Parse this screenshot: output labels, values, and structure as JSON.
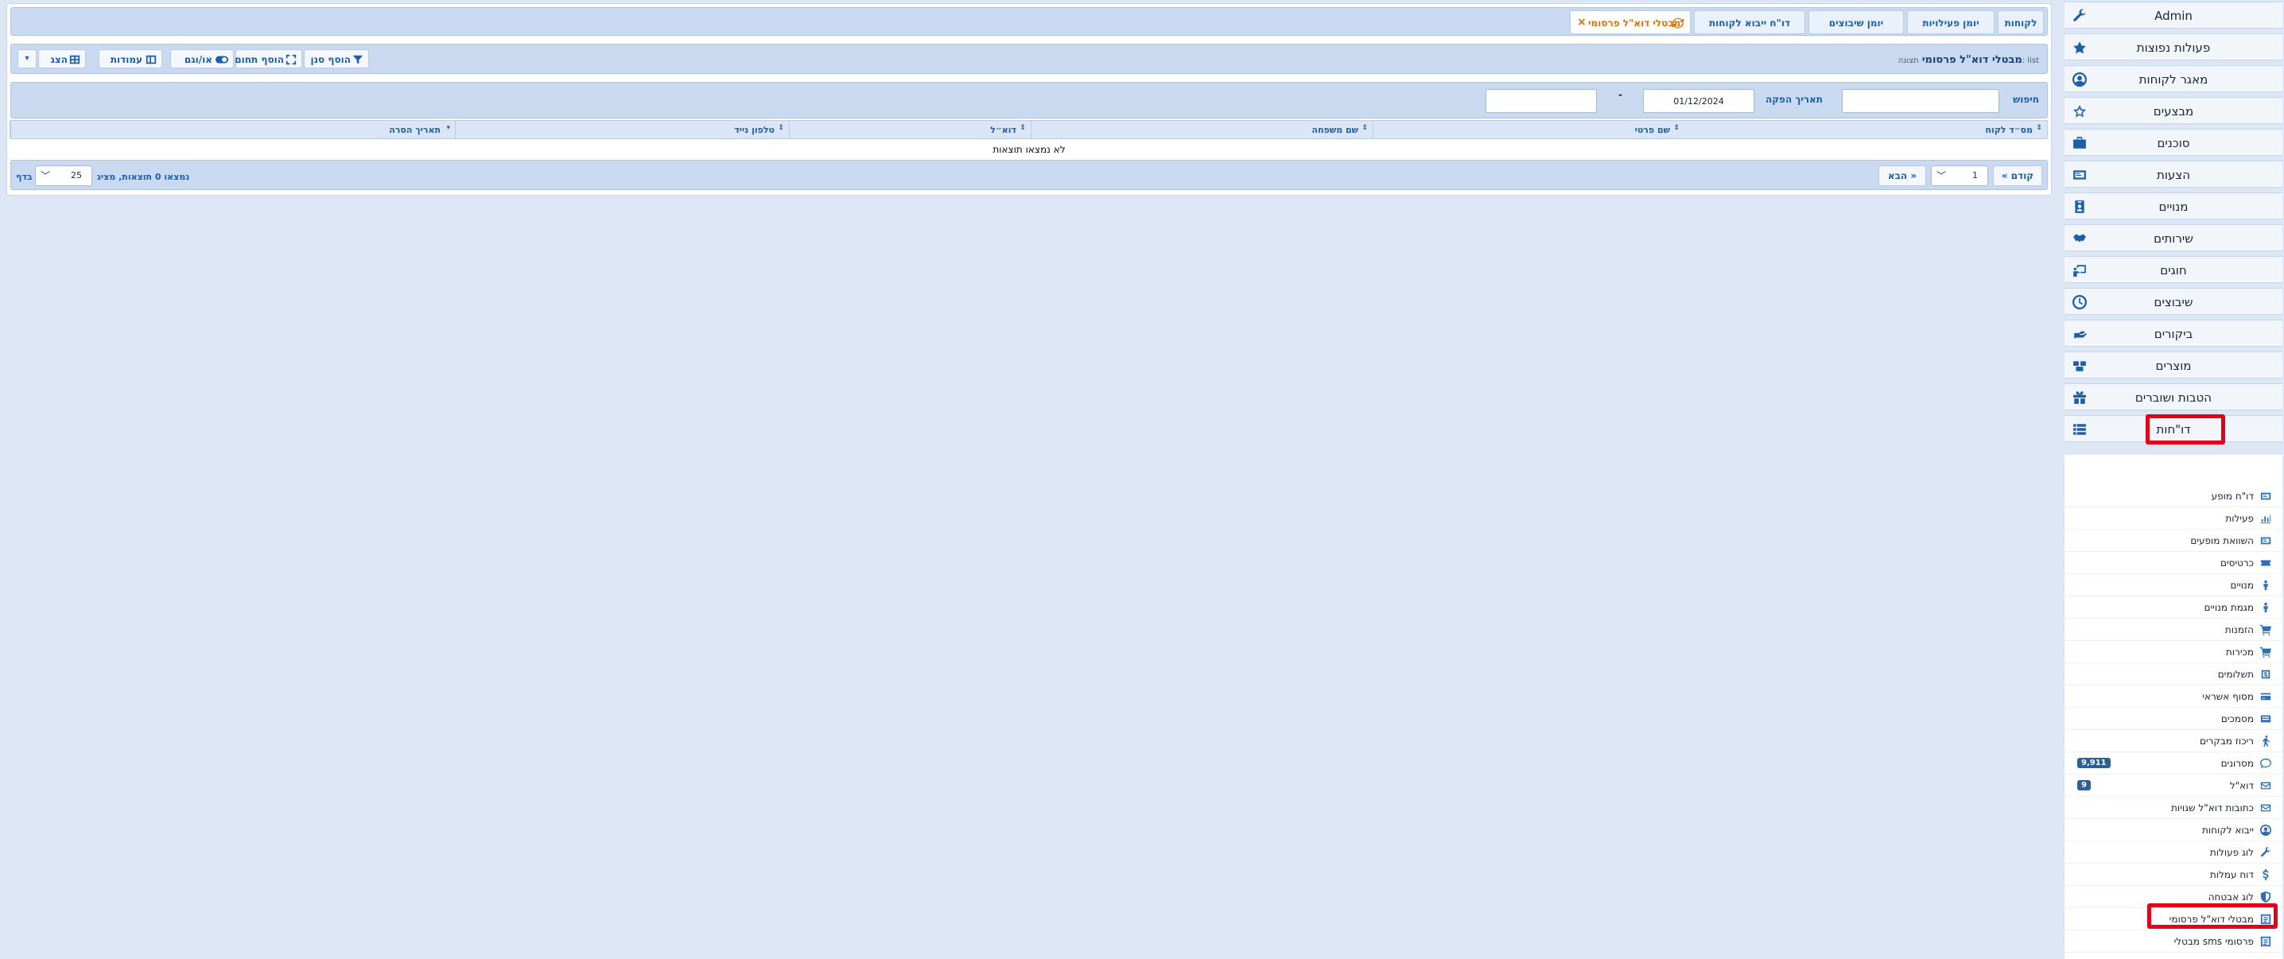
{
  "sidebar": {
    "items": [
      {
        "label": "Admin",
        "icon": "wrench-icon"
      },
      {
        "label": "פעולות נפוצות",
        "icon": "star-icon"
      },
      {
        "label": "מאגר לקוחות",
        "icon": "user-circle-icon"
      },
      {
        "label": "מבצעים",
        "icon": "star-outline-icon"
      },
      {
        "label": "סוכנים",
        "icon": "briefcase-icon"
      },
      {
        "label": "הצעות",
        "icon": "card-icon"
      },
      {
        "label": "מנויים",
        "icon": "id-badge-icon"
      },
      {
        "label": "שירותים",
        "icon": "handshake-icon"
      },
      {
        "label": "חוגים",
        "icon": "chalkboard-icon"
      },
      {
        "label": "שיבוצים",
        "icon": "clock-icon"
      },
      {
        "label": "ביקורים",
        "icon": "hand-icon"
      },
      {
        "label": "מוצרים",
        "icon": "boxes-icon"
      },
      {
        "label": "הטבות ושוברים",
        "icon": "gift-icon"
      },
      {
        "label": "דו\"חות",
        "icon": "list-icon"
      }
    ],
    "submenu": [
      {
        "label": "דו\"ח מופע",
        "icon": "card-icon",
        "badge": ""
      },
      {
        "label": "פעילות",
        "icon": "chart-icon",
        "badge": ""
      },
      {
        "label": "השוואת מופעים",
        "icon": "card-icon",
        "badge": ""
      },
      {
        "label": "כרטיסים",
        "icon": "ticket-icon",
        "badge": ""
      },
      {
        "label": "מנויים",
        "icon": "person-icon",
        "badge": ""
      },
      {
        "label": "מגמת מנויים",
        "icon": "person-icon",
        "badge": ""
      },
      {
        "label": "הזמנות",
        "icon": "cart-icon",
        "badge": ""
      },
      {
        "label": "מכירות",
        "icon": "cart-icon",
        "badge": ""
      },
      {
        "label": "תשלומים",
        "icon": "money-icon",
        "badge": ""
      },
      {
        "label": "מסוף אשראי",
        "icon": "credit-card-icon",
        "badge": ""
      },
      {
        "label": "מסמכים",
        "icon": "document-icon",
        "badge": ""
      },
      {
        "label": "ריכוז מבקרים",
        "icon": "walker-icon",
        "badge": ""
      },
      {
        "label": "מסרונים",
        "icon": "comment-icon",
        "badge": "9,911"
      },
      {
        "label": "דוא\"ל",
        "icon": "envelope-icon",
        "badge": "9"
      },
      {
        "label": "כתובות דוא\"ל שגויות",
        "icon": "envelope-icon",
        "badge": ""
      },
      {
        "label": "ייבוא לקוחות",
        "icon": "user-circle-icon",
        "badge": ""
      },
      {
        "label": "לוג פעולות",
        "icon": "wrench-icon",
        "badge": ""
      },
      {
        "label": "דוח עמלות",
        "icon": "dollar-icon",
        "badge": ""
      },
      {
        "label": "לוג אבטחה",
        "icon": "shield-icon",
        "badge": ""
      },
      {
        "label": "מבטלי דוא\"ל פרסומי",
        "icon": "list-box-icon",
        "badge": ""
      },
      {
        "label": "מבטלי sms פרסומי",
        "icon": "list-box-icon",
        "badge": ""
      }
    ]
  },
  "tabs": [
    {
      "label": "לקוחות"
    },
    {
      "label": "יומן פעילויות"
    },
    {
      "label": "יומן שיבוצים"
    },
    {
      "label": "דו\"ח ייבוא לקוחות"
    },
    {
      "label": "מבטלי דוא\"ל פרסומי",
      "close": "×"
    }
  ],
  "toolbar": {
    "title": "מבטלי דוא\"ל פרסומי",
    "view_label": "תצוגה: list",
    "add_filter": "הוסף סנן",
    "add_range": "הוסף תחום",
    "toggle": "או/וגם",
    "columns": "עמודות",
    "show": "הצג",
    "caret": "▾"
  },
  "filters": {
    "search_label": "חיפוש",
    "search_value": "",
    "date_label": "תאריך הפקה",
    "date_value": "01/12/2024",
    "dash": "-",
    "date_to_value": ""
  },
  "table": {
    "columns": [
      "מס״ד לקוח",
      "שם פרטי",
      "שם משפחה",
      "דוא״ל",
      "טלפון נייד",
      "תאריך הסרה"
    ],
    "empty_message": "לא נמצאו תוצאות"
  },
  "pager": {
    "prev": "« קודם",
    "page": "1",
    "next": "הבא »",
    "results_text": "נמצאו 0 תוצאות, מציג",
    "per_page": "25",
    "per_page_suffix": "בדף"
  },
  "colors": {
    "accent": "#1c5ea8",
    "highlight": "#e3001b",
    "active_tab": "#e07000",
    "badge": "#2b5f96"
  }
}
